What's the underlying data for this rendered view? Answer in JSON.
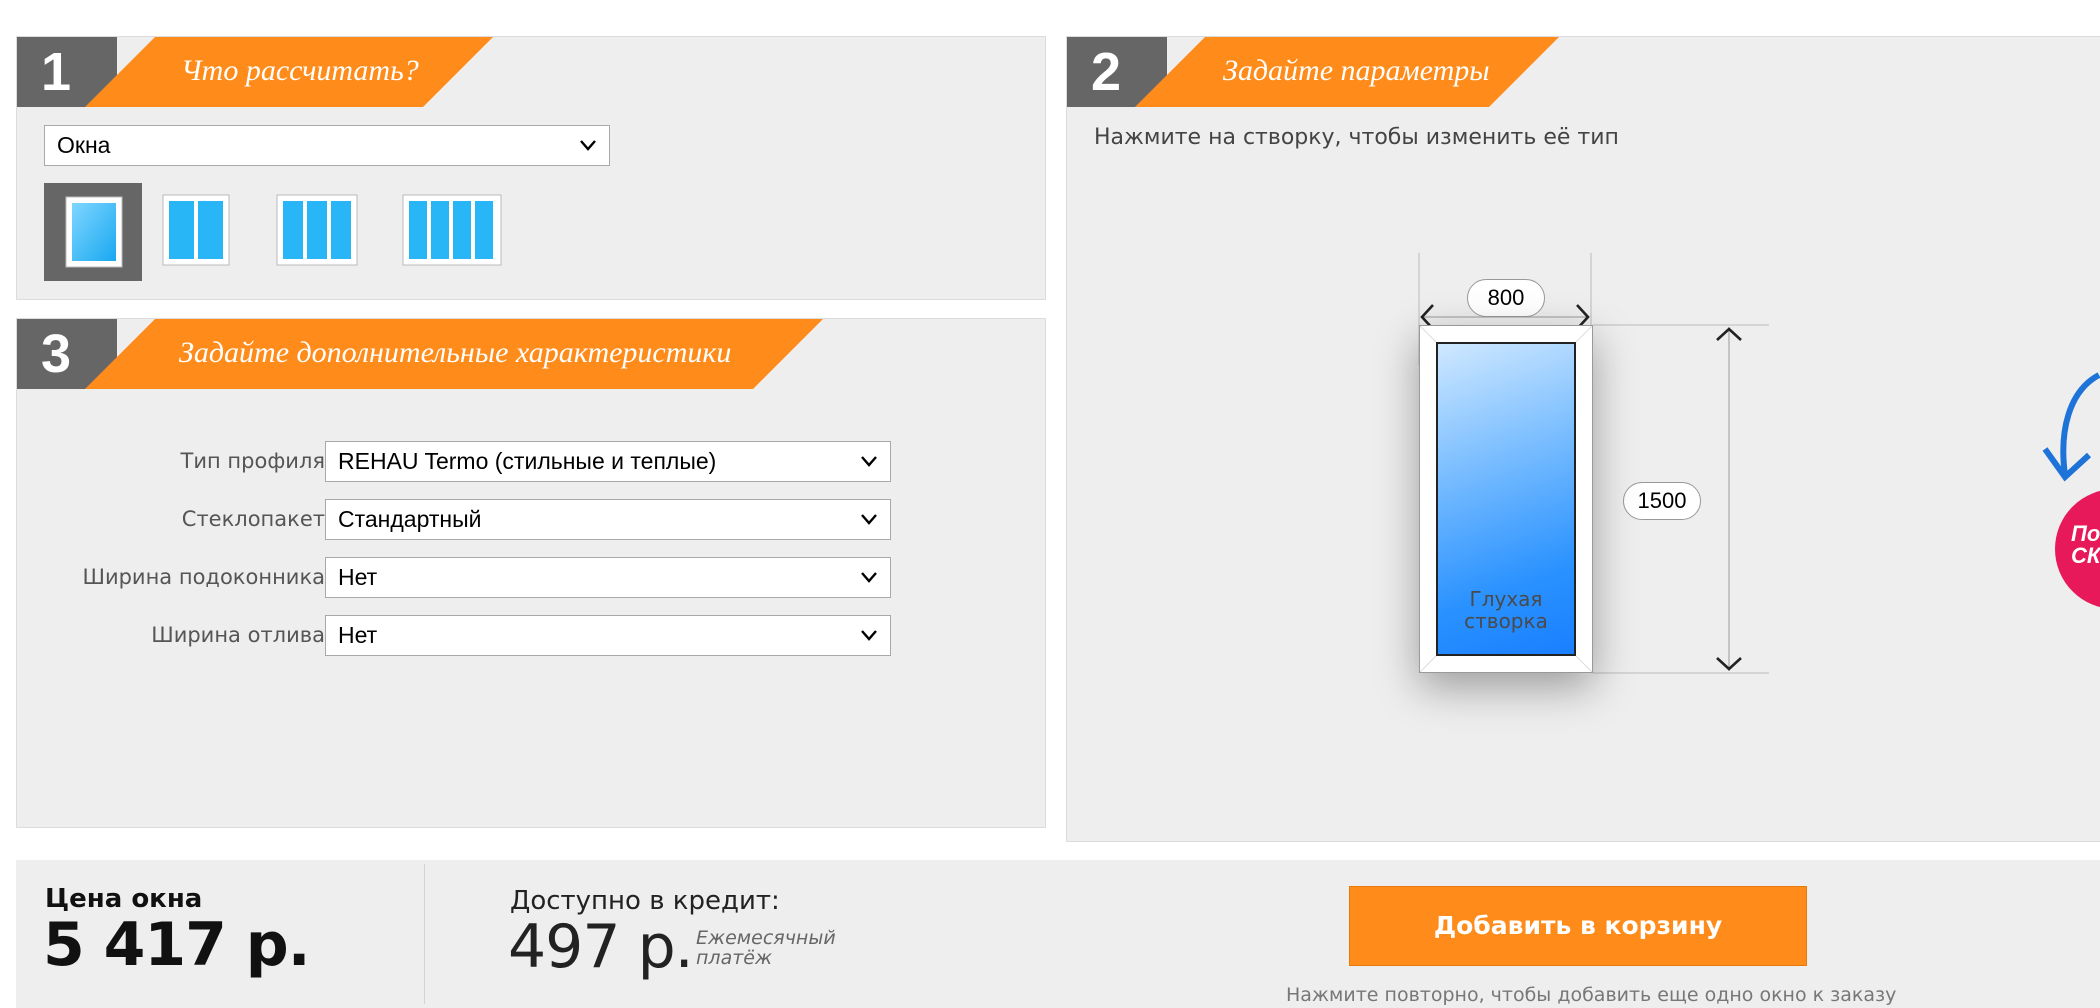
{
  "step1": {
    "number": "1",
    "title": "Что рассчитать?",
    "product_select": "Окна",
    "window_types": [
      {
        "name": "one-sash",
        "selected": true
      },
      {
        "name": "two-sash",
        "selected": false
      },
      {
        "name": "three-sash",
        "selected": false
      },
      {
        "name": "four-sash",
        "selected": false
      }
    ]
  },
  "step2": {
    "number": "2",
    "title": "Задайте параметры",
    "hint": "Нажмите на створку, чтобы изменить её тип",
    "width_value": "800",
    "height_value": "1500",
    "sash_label_line1": "Глухая",
    "sash_label_line2": "створка",
    "promo_badge_line1": "По",
    "promo_badge_line2": "СК"
  },
  "step3": {
    "number": "3",
    "title": "Задайте дополнительные характеристики",
    "fields": [
      {
        "label": "Тип профиля",
        "value": "REHAU Termo (стильные и теплые)"
      },
      {
        "label": "Стеклопакет",
        "value": "Стандартный"
      },
      {
        "label": "Ширина подоконника",
        "value": "Нет"
      },
      {
        "label": "Ширина отлива",
        "value": "Нет"
      }
    ]
  },
  "price": {
    "label": "Цена окна",
    "value": "5 417 р."
  },
  "credit": {
    "label": "Доступно в кредит:",
    "value": "497 р.",
    "note_line1": "Ежемесячный",
    "note_line2": "платёж"
  },
  "cart": {
    "button_label": "Добавить в корзину",
    "hint": "Нажмите повторно, чтобы добавить еще одно окно к заказу"
  },
  "colors": {
    "accent": "#ff8c1a",
    "step_number_bg": "#666666",
    "panel_bg": "#eeeeee",
    "promo_badge": "#e8195a",
    "arrow_blue": "#1e73d8"
  }
}
